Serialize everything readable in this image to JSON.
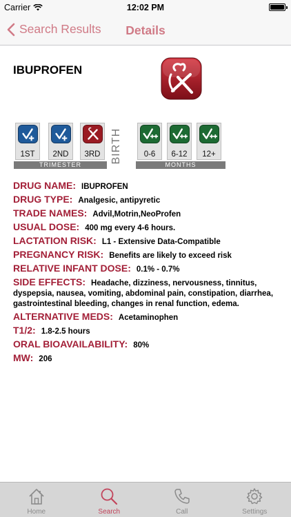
{
  "status_bar": {
    "carrier": "Carrier",
    "time": "12:02 PM"
  },
  "nav": {
    "back_label": "Search Results",
    "title": "Details"
  },
  "drug": {
    "title": "IBUPROFEN"
  },
  "risk_chart": {
    "cells": [
      {
        "label": "1ST",
        "color": "#1f5a9a",
        "symbol": "+"
      },
      {
        "label": "2ND",
        "color": "#1f5a9a",
        "symbol": "+"
      },
      {
        "label": "3RD",
        "color": "#9a1b23",
        "symbol": "x"
      },
      {
        "label": "0-6",
        "color": "#1d6a33",
        "symbol": "++"
      },
      {
        "label": "6-12",
        "color": "#1d6a33",
        "symbol": "++"
      },
      {
        "label": "12+",
        "color": "#1d6a33",
        "symbol": "++"
      }
    ],
    "trimester_label": "TRIMESTER",
    "birth_label": "BIRTH",
    "months_label": "MONTHS"
  },
  "info": [
    {
      "key": "DRUG NAME:",
      "value": "IBUPROFEN"
    },
    {
      "key": "DRUG TYPE:",
      "value": "Analgesic, antipyretic"
    },
    {
      "key": "TRADE NAMES:",
      "value": "Advil,Motrin,NeoProfen"
    },
    {
      "key": "USUAL DOSE:",
      "value": "400 mg every 4-6 hours."
    },
    {
      "key": "LACTATION RISK:",
      "value": "L1 - Extensive Data-Compatible"
    },
    {
      "key": "PREGNANCY RISK:",
      "value": "Benefits are likely to exceed risk"
    },
    {
      "key": "RELATIVE INFANT DOSE:",
      "value": "0.1% - 0.7%"
    },
    {
      "key": "SIDE EFFECTS:",
      "value": "Headache, dizziness, nervousness, tinnitus, dyspepsia, nausea, vomiting, abdominal pain, constipation, diarrhea, gastrointestinal bleeding, changes in renal function, edema."
    },
    {
      "key": "ALTERNATIVE MEDS:",
      "value": "Acetaminophen"
    },
    {
      "key": "T1/2:",
      "value": "1.8-2.5 hours"
    },
    {
      "key": "ORAL BIOAVAILABILITY:",
      "value": "80%"
    },
    {
      "key": "MW:",
      "value": "206"
    }
  ],
  "tabs": [
    {
      "label": "Home",
      "icon": "home-icon"
    },
    {
      "label": "Search",
      "icon": "search-icon",
      "active": true
    },
    {
      "label": "Call",
      "icon": "phone-icon"
    },
    {
      "label": "Settings",
      "icon": "gear-icon"
    }
  ],
  "colors": {
    "accent": "#c2445b",
    "key_text": "#a31f37",
    "nav_tint": "#d07a86"
  }
}
